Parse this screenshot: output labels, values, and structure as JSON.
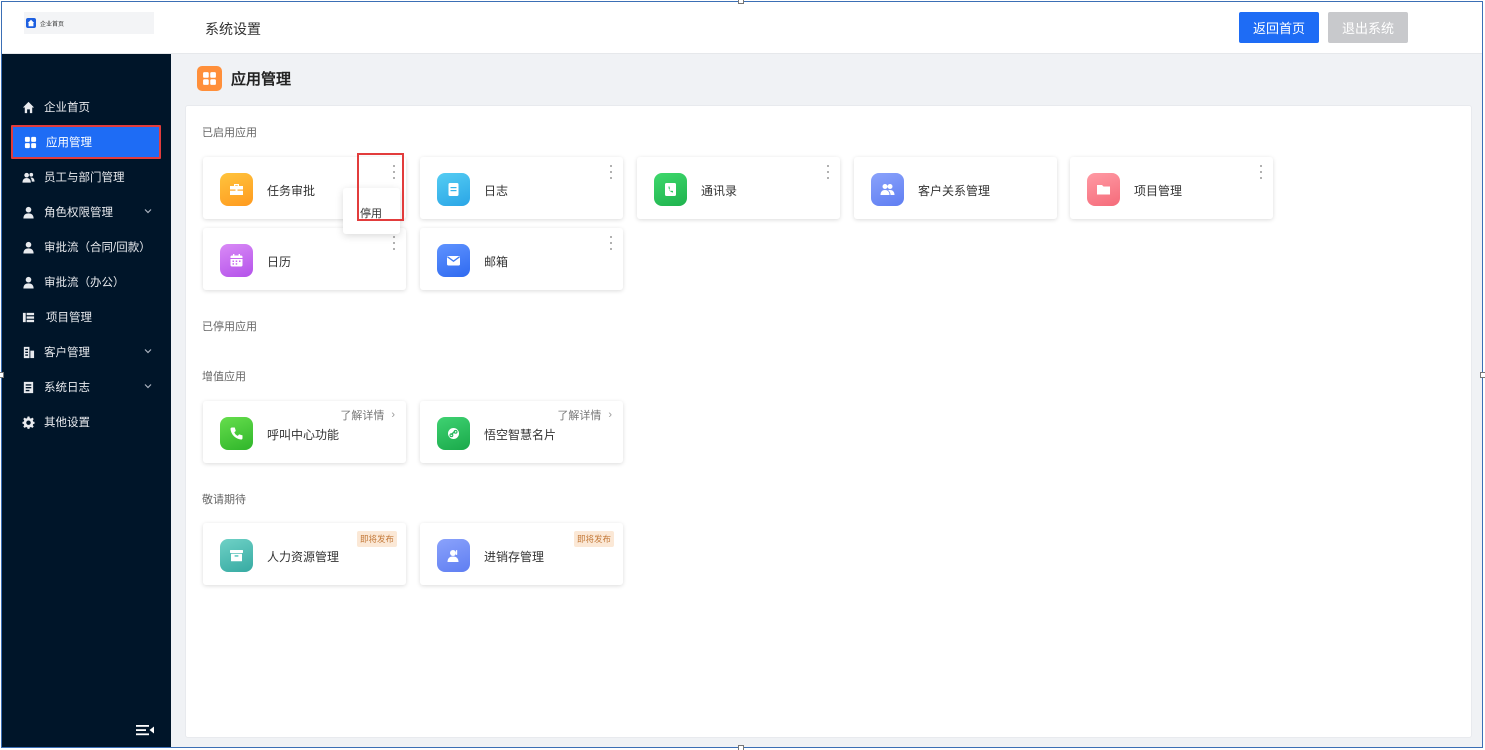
{
  "header": {
    "logo_text": "企业首页",
    "title": "系统设置",
    "home_button": "返回首页",
    "exit_button": "退出系统"
  },
  "sidebar": {
    "items": [
      {
        "label": "企业首页",
        "icon": "home-icon",
        "active": false,
        "expandable": false
      },
      {
        "label": "应用管理",
        "icon": "grid-apps-icon",
        "active": true,
        "expandable": false
      },
      {
        "label": "员工与部门管理",
        "icon": "users-icon",
        "active": false,
        "expandable": false
      },
      {
        "label": "角色权限管理",
        "icon": "user-icon",
        "active": false,
        "expandable": true
      },
      {
        "label": "审批流（合同/回款）",
        "icon": "user-icon",
        "active": false,
        "expandable": false
      },
      {
        "label": "审批流（办公）",
        "icon": "user-icon",
        "active": false,
        "expandable": false
      },
      {
        "label": "项目管理",
        "icon": "list-icon",
        "active": false,
        "expandable": false
      },
      {
        "label": "客户管理",
        "icon": "building-icon",
        "active": false,
        "expandable": true
      },
      {
        "label": "系统日志",
        "icon": "document-icon",
        "active": false,
        "expandable": true
      },
      {
        "label": "其他设置",
        "icon": "gear-icon",
        "active": false,
        "expandable": false
      }
    ]
  },
  "main": {
    "title": "应用管理",
    "sections": {
      "enabled": {
        "label": "已启用应用",
        "apps": [
          {
            "name": "任务审批",
            "icon": "briefcase-icon",
            "color": "#ffa928"
          },
          {
            "name": "日志",
            "icon": "note-icon",
            "color": "#36b4ea"
          },
          {
            "name": "通讯录",
            "icon": "phone-book-icon",
            "color": "#2ac45d"
          },
          {
            "name": "客户关系管理",
            "icon": "customers-icon",
            "color": "#6f8cf6"
          },
          {
            "name": "项目管理",
            "icon": "folder-icon",
            "color": "#f97e8b"
          },
          {
            "name": "日历",
            "icon": "calendar-icon",
            "color": "#c868f0"
          },
          {
            "name": "邮箱",
            "icon": "mail-icon",
            "color": "#3f7cf5"
          }
        ]
      },
      "disabled": {
        "label": "已停用应用"
      },
      "value_added": {
        "label": "增值应用",
        "detail_label": "了解详情",
        "apps": [
          {
            "name": "呼叫中心功能",
            "icon": "phone-icon",
            "color": "#48c83c"
          },
          {
            "name": "悟空智慧名片",
            "icon": "link-card-icon",
            "color": "#26b85e"
          }
        ]
      },
      "coming_soon": {
        "label": "敬请期待",
        "badge": "即将发布",
        "apps": [
          {
            "name": "人力资源管理",
            "icon": "archive-icon",
            "color": "#4ac0b8"
          },
          {
            "name": "进销存管理",
            "icon": "person-card-icon",
            "color": "#6f8cf6"
          }
        ]
      }
    },
    "dropdown": {
      "disable_label": "停用"
    }
  }
}
